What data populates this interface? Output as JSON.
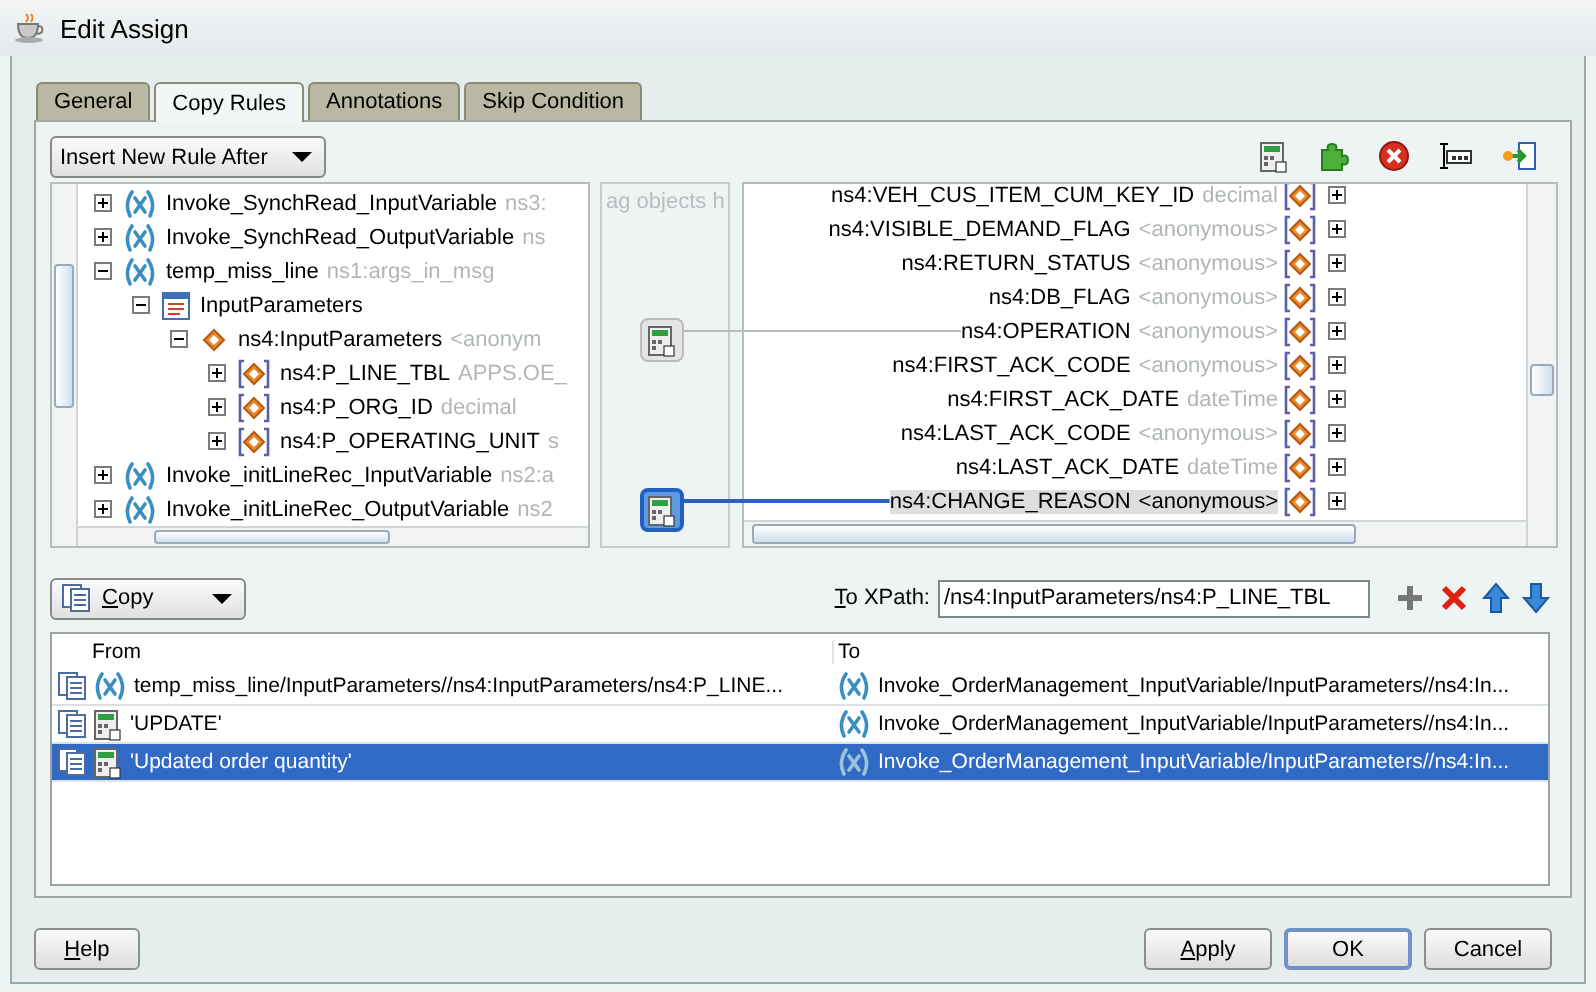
{
  "window": {
    "title": "Edit Assign"
  },
  "tabs": [
    {
      "label": "General",
      "selected": false
    },
    {
      "label": "Copy Rules",
      "selected": true
    },
    {
      "label": "Annotations",
      "selected": false
    },
    {
      "label": "Skip Condition",
      "selected": false
    }
  ],
  "rule_position": {
    "value": "Insert New Rule After"
  },
  "source_tree": {
    "items": [
      {
        "kind": "variable",
        "name": "Invoke_SynchRead_InputVariable",
        "type": "ns3:",
        "expanded": false
      },
      {
        "kind": "variable",
        "name": "Invoke_SynchRead_OutputVariable",
        "type": "ns",
        "expanded": false
      },
      {
        "kind": "variable",
        "name": "temp_miss_line",
        "type": "ns1:args_in_msg",
        "expanded": true,
        "children": [
          {
            "kind": "part",
            "name": "InputParameters",
            "expanded": true,
            "children": [
              {
                "kind": "element",
                "name": "ns4:InputParameters",
                "type": "<anonym",
                "expanded": true,
                "children": [
                  {
                    "kind": "field",
                    "name": "ns4:P_LINE_TBL",
                    "type": "APPS.OE_",
                    "expanded": false
                  },
                  {
                    "kind": "field",
                    "name": "ns4:P_ORG_ID",
                    "type": "decimal",
                    "expanded": false
                  },
                  {
                    "kind": "field",
                    "name": "ns4:P_OPERATING_UNIT",
                    "type": "s",
                    "expanded": false
                  }
                ]
              }
            ]
          }
        ]
      },
      {
        "kind": "variable",
        "name": "Invoke_initLineRec_InputVariable",
        "type": "ns2:a",
        "expanded": false
      },
      {
        "kind": "variable",
        "name": "Invoke_initLineRec_OutputVariable",
        "type": "ns2",
        "expanded": false
      }
    ]
  },
  "function_panel": {
    "hint": "ag objects h",
    "functions": [
      {
        "selected": false
      },
      {
        "selected": true
      }
    ]
  },
  "target_tree": {
    "items": [
      {
        "name": "ns4:VEH_CUS_ITEM_CUM_KEY_ID",
        "type": "decimal",
        "linked": false,
        "selected": false
      },
      {
        "name": "ns4:VISIBLE_DEMAND_FLAG",
        "type": "<anonymous>",
        "linked": false,
        "selected": false
      },
      {
        "name": "ns4:RETURN_STATUS",
        "type": "<anonymous>",
        "linked": false,
        "selected": false
      },
      {
        "name": "ns4:DB_FLAG",
        "type": "<anonymous>",
        "linked": false,
        "selected": false
      },
      {
        "name": "ns4:OPERATION",
        "type": "<anonymous>",
        "linked": true,
        "selected": false
      },
      {
        "name": "ns4:FIRST_ACK_CODE",
        "type": "<anonymous>",
        "linked": false,
        "selected": false
      },
      {
        "name": "ns4:FIRST_ACK_DATE",
        "type": "dateTime",
        "linked": false,
        "selected": false
      },
      {
        "name": "ns4:LAST_ACK_CODE",
        "type": "<anonymous>",
        "linked": false,
        "selected": false
      },
      {
        "name": "ns4:LAST_ACK_DATE",
        "type": "dateTime",
        "linked": false,
        "selected": false
      },
      {
        "name": "ns4:CHANGE_REASON",
        "type": "<anonymous>",
        "linked": true,
        "selected": true
      }
    ]
  },
  "copy_rule": {
    "operation": "Copy",
    "to_xpath_label": "To XPath:",
    "to_xpath": "/ns4:InputParameters/ns4:P_LINE_TBL"
  },
  "rules_table": {
    "columns": [
      "From",
      "To"
    ],
    "rows": [
      {
        "from": {
          "kind": "variable",
          "text": "temp_miss_line/InputParameters//ns4:InputParameters/ns4:P_LINE..."
        },
        "to": {
          "kind": "variable",
          "text": "Invoke_OrderManagement_InputVariable/InputParameters//ns4:In..."
        },
        "selected": false
      },
      {
        "from": {
          "kind": "function",
          "text": "'UPDATE'"
        },
        "to": {
          "kind": "variable",
          "text": "Invoke_OrderManagement_InputVariable/InputParameters//ns4:In..."
        },
        "selected": false
      },
      {
        "from": {
          "kind": "function",
          "text": "'Updated order quantity'"
        },
        "to": {
          "kind": "variable",
          "text": "Invoke_OrderManagement_InputVariable/InputParameters//ns4:In..."
        },
        "selected": true
      }
    ]
  },
  "buttons": [
    {
      "label": "Help",
      "mnemonic": true,
      "default": false
    },
    {
      "label": "Apply",
      "mnemonic": true,
      "default": false
    },
    {
      "label": "OK",
      "mnemonic": false,
      "default": true
    },
    {
      "label": "Cancel",
      "mnemonic": false,
      "default": false
    }
  ]
}
